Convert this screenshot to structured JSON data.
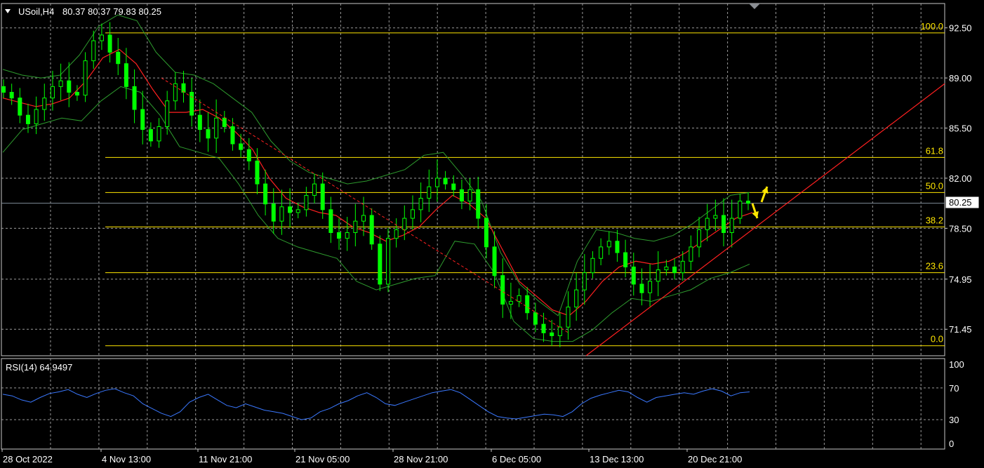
{
  "main_header": {
    "symbol": "USoil,H4",
    "ohlc": "80.37 80.37 79.83 80.25"
  },
  "rsi_header": {
    "label": "RSI(14) 64.9497"
  },
  "price_axis": {
    "ticks": [
      "92.50",
      "89.00",
      "85.50",
      "82.00",
      "78.50",
      "74.95",
      "71.45"
    ],
    "current_price": "80.25"
  },
  "rsi_axis": {
    "ticks": [
      "100",
      "70",
      "30",
      "0"
    ]
  },
  "time_axis": {
    "labels": [
      "28 Oct 2022",
      "4 Nov 13:00",
      "11 Nov 21:00",
      "21 Nov 05:00",
      "28 Nov 21:00",
      "6 Dec 05:00",
      "13 Dec 13:00",
      "20 Dec 21:00"
    ]
  },
  "fibonacci": {
    "levels": [
      "100.0",
      "61.8",
      "50.0",
      "38.2",
      "23.6",
      "0.0"
    ]
  },
  "colors": {
    "background": "#000000",
    "grid": "#9a9a9a",
    "candle": "#00ff00",
    "bollinger": "#2e9b2e",
    "moving_average": "#ff2020",
    "trendline": "#ff2020",
    "fibonacci": "#ffe600",
    "rsi": "#3a78ff",
    "arrows": "#ffe600",
    "current_price_line": "#7f8c99"
  },
  "chart_data": [
    {
      "type": "candlestick",
      "symbol": "USoil",
      "timeframe": "H4",
      "ylim": [
        69.6,
        94.2
      ],
      "x_categories": [
        "28 Oct 2022",
        "4 Nov 13:00",
        "11 Nov 21:00",
        "21 Nov 05:00",
        "28 Nov 21:00",
        "6 Dec 05:00",
        "13 Dec 13:00",
        "20 Dec 21:00"
      ],
      "close_series": [
        88.0,
        87.6,
        86.4,
        85.8,
        86.8,
        87.6,
        88.4,
        88.8,
        88.0,
        87.8,
        90.2,
        91.6,
        92.0,
        90.8,
        90.0,
        88.4,
        86.8,
        85.4,
        84.6,
        85.6,
        87.4,
        88.6,
        88.0,
        86.4,
        85.4,
        84.8,
        86.2,
        85.6,
        84.4,
        84.0,
        83.2,
        81.6,
        80.2,
        79.0,
        80.0,
        79.6,
        79.8,
        80.8,
        81.6,
        79.8,
        78.2,
        77.8,
        78.2,
        79.0,
        79.4,
        77.4,
        74.6,
        77.8,
        78.4,
        79.2,
        79.8,
        80.6,
        81.4,
        82.0,
        81.6,
        81.2,
        80.4,
        81.2,
        79.2,
        77.2,
        75.2,
        73.2,
        73.4,
        73.8,
        72.6,
        71.8,
        71.2,
        71.0,
        71.6,
        73.0,
        74.2,
        75.4,
        76.4,
        77.2,
        77.6,
        76.8,
        75.8,
        74.6,
        74.0,
        74.8,
        75.6,
        75.8,
        75.4,
        76.2,
        77.2,
        78.4,
        79.2,
        79.4,
        78.2,
        79.2,
        80.4,
        80.25
      ],
      "moving_average": [
        87.6,
        87.3,
        87.0,
        87.2,
        87.6,
        88.8,
        90.4,
        91.0,
        90.0,
        88.2,
        86.6,
        86.6,
        86.8,
        86.2,
        85.2,
        84.0,
        82.0,
        80.6,
        80.0,
        79.6,
        79.4,
        78.6,
        78.2,
        77.6,
        78.0,
        78.6,
        79.8,
        80.8,
        80.2,
        79.2,
        77.0,
        74.8,
        73.8,
        72.8,
        72.4,
        73.4,
        74.8,
        75.8,
        76.2,
        76.0,
        76.2,
        76.8,
        77.6,
        78.4,
        79.2,
        79.6
      ],
      "bollinger_upper": [
        89.6,
        89.2,
        89.0,
        89.2,
        90.6,
        92.6,
        93.4,
        93.0,
        90.8,
        89.4,
        89.2,
        88.6,
        87.6,
        86.6,
        84.6,
        83.2,
        82.4,
        82.0,
        81.6,
        81.8,
        82.2,
        82.6,
        83.6,
        83.8,
        82.2,
        80.4,
        76.8,
        74.6,
        73.4,
        72.4,
        76.2,
        78.4,
        78.2,
        77.8,
        77.6,
        78.0,
        78.8,
        79.8,
        80.8,
        81.0
      ],
      "bollinger_lower": [
        83.8,
        85.4,
        85.8,
        86.2,
        86.0,
        87.4,
        88.4,
        88.0,
        86.4,
        84.2,
        83.8,
        83.4,
        81.6,
        79.4,
        77.8,
        77.2,
        76.8,
        76.4,
        74.8,
        74.2,
        74.6,
        75.0,
        75.2,
        77.6,
        77.4,
        75.4,
        72.0,
        70.8,
        70.6,
        70.6,
        71.4,
        72.6,
        73.6,
        73.4,
        73.8,
        74.2,
        75.0,
        75.4,
        76.0
      ],
      "rsi_series": [
        62,
        60,
        55,
        52,
        58,
        63,
        65,
        68,
        62,
        58,
        63,
        67,
        69,
        64,
        60,
        50,
        44,
        38,
        34,
        40,
        52,
        58,
        62,
        55,
        48,
        45,
        50,
        46,
        42,
        40,
        38,
        34,
        30,
        32,
        40,
        44,
        50,
        54,
        60,
        64,
        58,
        50,
        48,
        52,
        56,
        60,
        64,
        66,
        68,
        64,
        56,
        48,
        40,
        34,
        32,
        31,
        33,
        35,
        37,
        36,
        34,
        40,
        50,
        57,
        61,
        64,
        67,
        65,
        58,
        52,
        58,
        60,
        62,
        64,
        62,
        66,
        69,
        66,
        60,
        64,
        65
      ],
      "rsi_levels": [
        70,
        30
      ],
      "rsi_ylim": [
        0,
        100
      ],
      "fibonacci_retracement": {
        "levels": [
          "100.0",
          "61.8",
          "50.0",
          "38.2",
          "23.6",
          "0.0"
        ]
      },
      "grid": true
    }
  ]
}
